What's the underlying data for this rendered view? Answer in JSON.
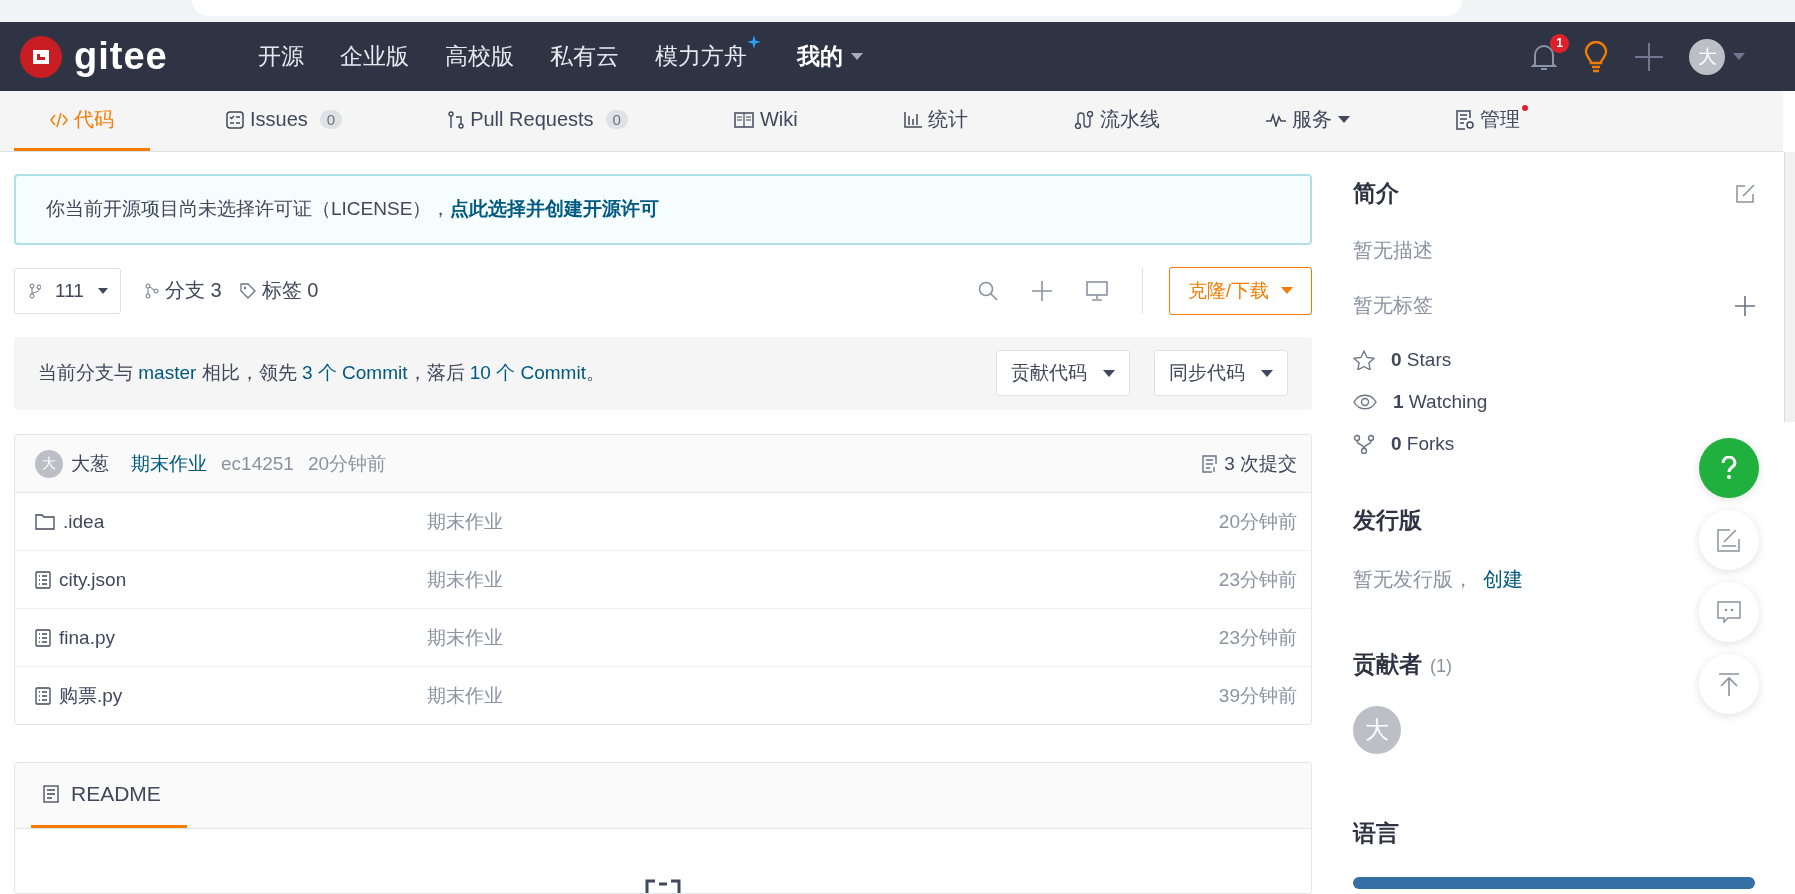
{
  "nav": {
    "logo": "gitee",
    "items": [
      {
        "label": "开源",
        "dropdown": false,
        "sparkle": false
      },
      {
        "label": "企业版",
        "dropdown": false,
        "sparkle": false
      },
      {
        "label": "高校版",
        "dropdown": false,
        "sparkle": false
      },
      {
        "label": "私有云",
        "dropdown": false,
        "sparkle": false
      },
      {
        "label": "模力方舟",
        "dropdown": false,
        "sparkle": true
      },
      {
        "label": "我的",
        "dropdown": true,
        "sparkle": false
      }
    ],
    "notifications": "1",
    "avatar": "大"
  },
  "tabs": [
    {
      "label": "代码",
      "selected": true
    },
    {
      "label": "Issues",
      "count": "0",
      "selected": false
    },
    {
      "label": "Pull Requests",
      "count": "0",
      "selected": false
    },
    {
      "label": "Wiki",
      "selected": false
    },
    {
      "label": "统计",
      "selected": false
    },
    {
      "label": "流水线",
      "selected": false
    },
    {
      "label": "服务",
      "dropdown": true,
      "selected": false
    },
    {
      "label": "管理",
      "dot": true,
      "selected": false
    }
  ],
  "notice": {
    "text": "你当前开源项目尚未选择许可证（LICENSE），",
    "link": "点此选择并创建开源许可"
  },
  "branch_bar": {
    "branch": "111",
    "branches": "分支 3",
    "tags": "标签 0",
    "clone": "克隆/下载"
  },
  "compare": {
    "parts": [
      {
        "text": "当前分支与 ",
        "link": false
      },
      {
        "text": "master",
        "link": true
      },
      {
        "text": " 相比，领先 ",
        "link": false
      },
      {
        "text": "3 个 Commit",
        "link": true
      },
      {
        "text": "，落后 ",
        "link": false
      },
      {
        "text": "10 个 Commit",
        "link": true
      },
      {
        "text": "。",
        "link": false
      }
    ],
    "buttons": [
      "贡献代码",
      "同步代码"
    ]
  },
  "commit": {
    "avatar": "大",
    "author": "大葱",
    "message": "期末作业",
    "hash": "ec14251",
    "time": "20分钟前",
    "count": "3 次提交"
  },
  "files": [
    {
      "kind": "folder",
      "name": ".idea",
      "message": "期末作业",
      "time": "20分钟前"
    },
    {
      "kind": "file",
      "name": "city.json",
      "message": "期末作业",
      "time": "23分钟前"
    },
    {
      "kind": "file",
      "name": "fina.py",
      "message": "期末作业",
      "time": "23分钟前"
    },
    {
      "kind": "file",
      "name": "购票.py",
      "message": "期末作业",
      "time": "39分钟前"
    }
  ],
  "readme": {
    "tab": "README"
  },
  "sidebar": {
    "about_title": "简介",
    "description": "暂无描述",
    "tags": "暂无标签",
    "stats": [
      {
        "count": "0",
        "label": "Stars"
      },
      {
        "count": "1",
        "label": "Watching"
      },
      {
        "count": "0",
        "label": "Forks"
      }
    ],
    "releases_title": "发行版",
    "releases_text": "暂无发行版，",
    "releases_link": "创建",
    "contributors_title": "贡献者",
    "contributors_count": "(1)",
    "contributors": [
      "大"
    ],
    "language_title": "语言"
  },
  "float_buttons": [
    {
      "kind": "help"
    },
    {
      "kind": "edit"
    },
    {
      "kind": "chat"
    },
    {
      "kind": "top"
    }
  ]
}
